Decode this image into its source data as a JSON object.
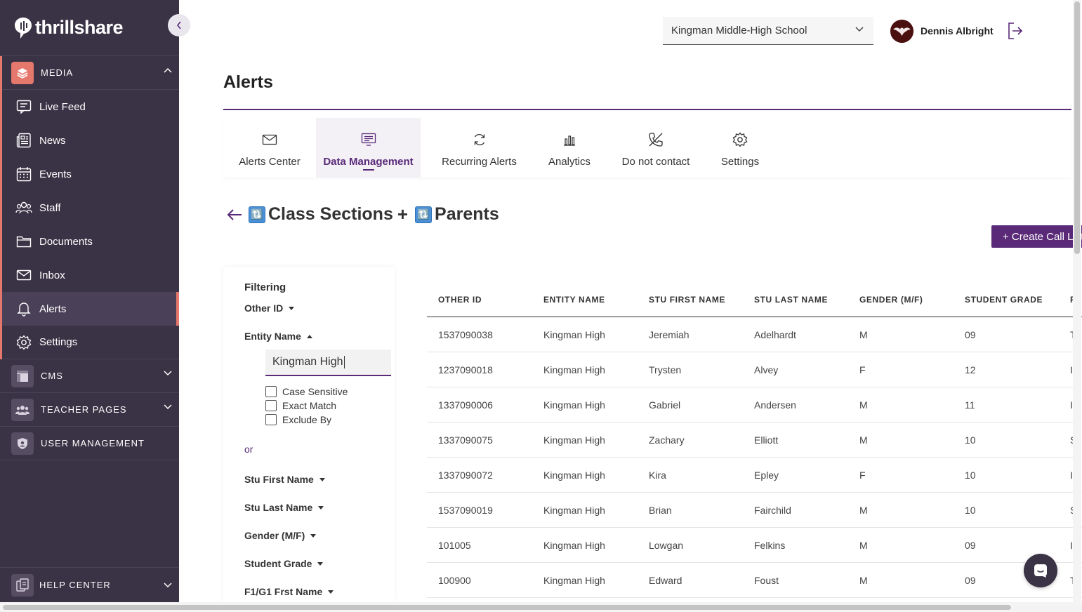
{
  "app": {
    "brand": "thrillshare"
  },
  "sidebar": {
    "media": {
      "label": "MEDIA",
      "items": [
        {
          "label": "Live Feed",
          "icon": "live-feed-icon"
        },
        {
          "label": "News",
          "icon": "news-icon"
        },
        {
          "label": "Events",
          "icon": "calendar-icon"
        },
        {
          "label": "Staff",
          "icon": "staff-icon"
        },
        {
          "label": "Documents",
          "icon": "folder-icon"
        },
        {
          "label": "Inbox",
          "icon": "envelope-icon"
        },
        {
          "label": "Alerts",
          "icon": "bell-icon",
          "active": true
        },
        {
          "label": "Settings",
          "icon": "gear-icon"
        }
      ]
    },
    "cms": "CMS",
    "teacher_pages": "TEACHER PAGES",
    "user_management": "USER MANAGEMENT",
    "help_center": "HELP CENTER"
  },
  "header": {
    "school": "Kingman Middle-High School",
    "user": "Dennis Albright"
  },
  "page": {
    "title": "Alerts",
    "tabs": [
      {
        "label": "Alerts Center",
        "icon": "envelope-icon"
      },
      {
        "label": "Data Management",
        "icon": "data-icon",
        "active": true
      },
      {
        "label": "Recurring Alerts",
        "icon": "refresh-icon"
      },
      {
        "label": "Analytics",
        "icon": "bar-chart-icon"
      },
      {
        "label": "Do not contact",
        "icon": "phone-off-icon"
      },
      {
        "label": "Settings",
        "icon": "gear-icon"
      }
    ],
    "heading": {
      "part1": "Class Sections",
      "plus": "+",
      "part2": "Parents",
      "badge": "🔃"
    },
    "create_button": "+ Create Call List"
  },
  "filter": {
    "title": "Filtering",
    "fields": {
      "other_id": "Other ID",
      "entity_name": "Entity Name",
      "stu_first_name": "Stu First Name",
      "stu_last_name": "Stu Last Name",
      "gender": "Gender (M/F)",
      "student_grade": "Student Grade",
      "f1g1_first_name": "F1/G1 Frst Name"
    },
    "entity_value": "Kingman High",
    "options": {
      "case_sensitive": "Case Sensitive",
      "exact_match": "Exact Match",
      "exclude_by": "Exclude By"
    },
    "or": "or"
  },
  "table": {
    "columns": [
      "OTHER ID",
      "ENTITY NAME",
      "STU FIRST NAME",
      "STU LAST NAME",
      "GENDER (M/F)",
      "STUDENT GRADE",
      "F"
    ],
    "rows": [
      [
        "1537090038",
        "Kingman High",
        "Jeremiah",
        "Adelhardt",
        "M",
        "09",
        "T"
      ],
      [
        "1237090018",
        "Kingman High",
        "Trysten",
        "Alvey",
        "F",
        "12",
        "I"
      ],
      [
        "1337090006",
        "Kingman High",
        "Gabriel",
        "Andersen",
        "M",
        "11",
        "I"
      ],
      [
        "1337090075",
        "Kingman High",
        "Zachary",
        "Elliott",
        "M",
        "10",
        "S"
      ],
      [
        "1337090072",
        "Kingman High",
        "Kira",
        "Epley",
        "F",
        "10",
        "I"
      ],
      [
        "1537090019",
        "Kingman High",
        "Brian",
        "Fairchild",
        "M",
        "10",
        "S"
      ],
      [
        "101005",
        "Kingman High",
        "Lowgan",
        "Felkins",
        "M",
        "09",
        "I"
      ],
      [
        "100900",
        "Kingman High",
        "Edward",
        "Foust",
        "M",
        "09",
        "T"
      ]
    ]
  },
  "colors": {
    "sidebar": "#3a3245",
    "accent": "#5a2a78",
    "highlight": "#e5786d"
  }
}
